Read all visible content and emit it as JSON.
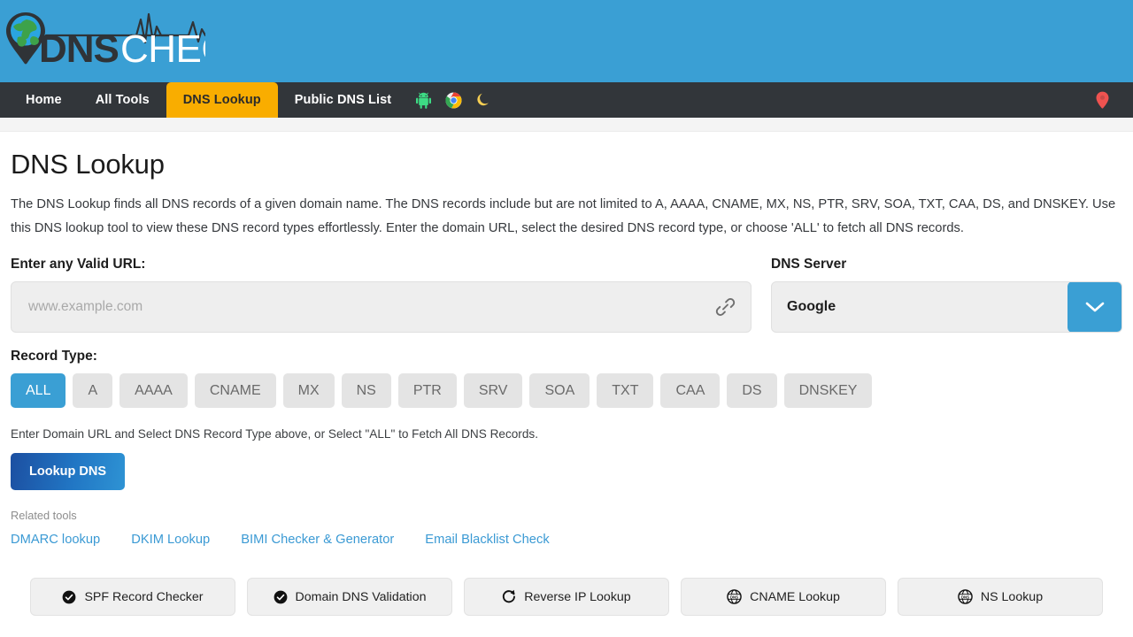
{
  "site": {
    "logo_primary": "DNS",
    "logo_secondary": "CHECKER"
  },
  "nav": {
    "items": [
      {
        "label": "Home",
        "active": false
      },
      {
        "label": "All Tools",
        "active": false
      },
      {
        "label": "DNS Lookup",
        "active": true
      },
      {
        "label": "Public DNS List",
        "active": false
      }
    ],
    "icons": [
      {
        "name": "android-icon"
      },
      {
        "name": "chrome-icon"
      },
      {
        "name": "moon-icon"
      }
    ],
    "right_icon": {
      "name": "location-pin-icon"
    }
  },
  "page": {
    "title": "DNS Lookup",
    "description": "The DNS Lookup finds all DNS records of a given domain name. The DNS records include but are not limited to A, AAAA, CNAME, MX, NS, PTR, SRV, SOA, TXT, CAA, DS, and DNSKEY. Use this DNS lookup tool to view these DNS record types effortlessly. Enter the domain URL, select the desired DNS record type, or choose 'ALL' to fetch all DNS records."
  },
  "form": {
    "url_label": "Enter any Valid URL:",
    "url_value": "",
    "url_placeholder": "www.example.com",
    "dns_server_label": "DNS Server",
    "dns_server_value": "Google",
    "record_type_label": "Record Type:",
    "record_types": [
      {
        "label": "ALL",
        "active": true
      },
      {
        "label": "A",
        "active": false
      },
      {
        "label": "AAAA",
        "active": false
      },
      {
        "label": "CNAME",
        "active": false
      },
      {
        "label": "MX",
        "active": false
      },
      {
        "label": "NS",
        "active": false
      },
      {
        "label": "PTR",
        "active": false
      },
      {
        "label": "SRV",
        "active": false
      },
      {
        "label": "SOA",
        "active": false
      },
      {
        "label": "TXT",
        "active": false
      },
      {
        "label": "CAA",
        "active": false
      },
      {
        "label": "DS",
        "active": false
      },
      {
        "label": "DNSKEY",
        "active": false
      }
    ],
    "hint": "Enter Domain URL and Select DNS Record Type above, or Select \"ALL\" to Fetch All DNS Records.",
    "submit_label": "Lookup DNS"
  },
  "related": {
    "label": "Related tools",
    "links": [
      "DMARC lookup",
      "DKIM Lookup",
      "BIMI Checker & Generator",
      "Email Blacklist Check"
    ]
  },
  "tools": [
    {
      "label": "SPF Record Checker",
      "icon": "check-circle-icon"
    },
    {
      "label": "Domain DNS Validation",
      "icon": "check-circle-icon"
    },
    {
      "label": "Reverse IP Lookup",
      "icon": "refresh-icon"
    },
    {
      "label": "CNAME Lookup",
      "icon": "dns-globe-icon"
    },
    {
      "label": "NS Lookup",
      "icon": "dns-globe-icon"
    }
  ],
  "colors": {
    "header_blue": "#3a9fd4",
    "nav_dark": "#32363a",
    "active_tab_amber": "#f9ad00",
    "accent_blue": "#3a9fd4",
    "link_blue": "#3b9ad4",
    "pin_red": "#ef5350"
  }
}
